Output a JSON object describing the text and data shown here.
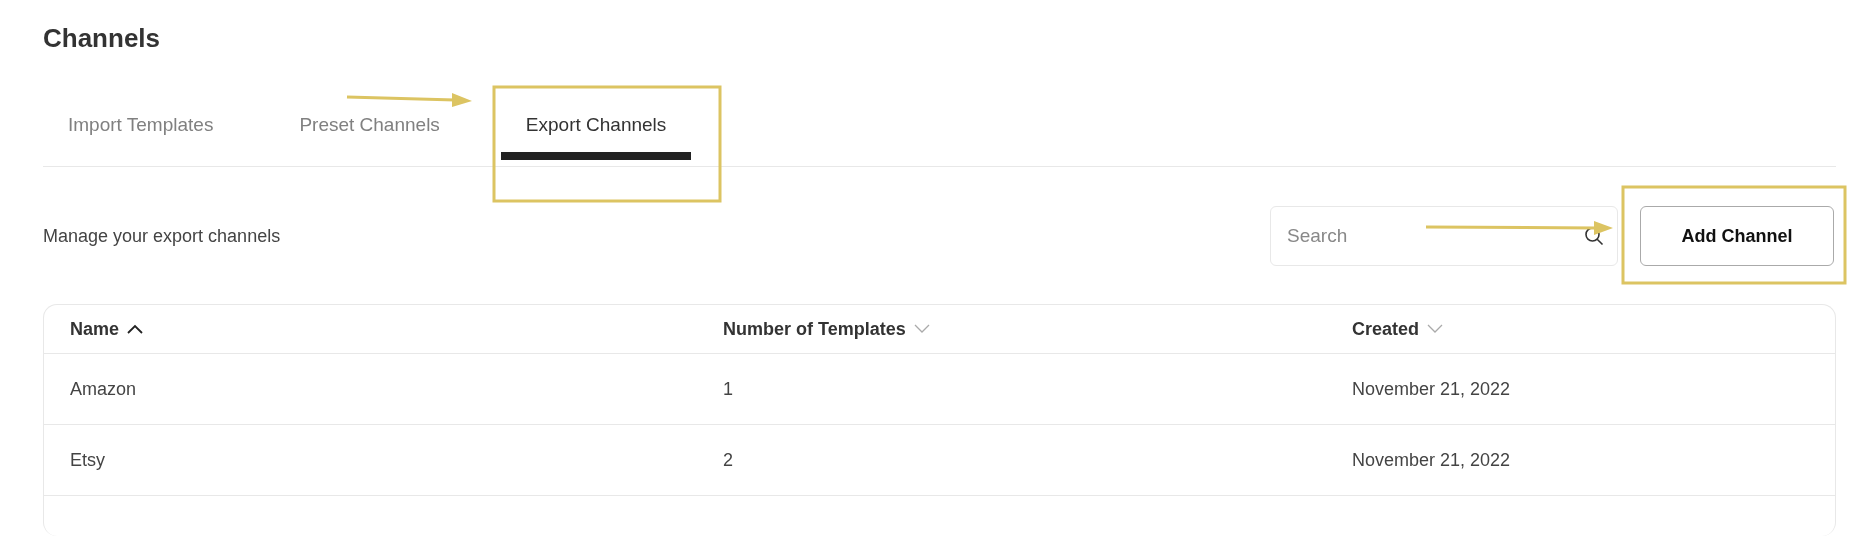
{
  "title": "Channels",
  "tabs": [
    {
      "label": "Import Templates",
      "selected": false
    },
    {
      "label": "Preset Channels",
      "selected": false
    },
    {
      "label": "Export Channels",
      "selected": true
    }
  ],
  "description": "Manage your export channels",
  "search": {
    "placeholder": "Search"
  },
  "add_button": "Add Channel",
  "table": {
    "columns": [
      {
        "label": "Name",
        "sorted": true
      },
      {
        "label": "Number of Templates",
        "sorted": false
      },
      {
        "label": "Created",
        "sorted": false
      }
    ],
    "rows": [
      [
        "Amazon",
        "1",
        "November 21, 2022"
      ],
      [
        "Etsy",
        "2",
        "November 21, 2022"
      ]
    ]
  }
}
